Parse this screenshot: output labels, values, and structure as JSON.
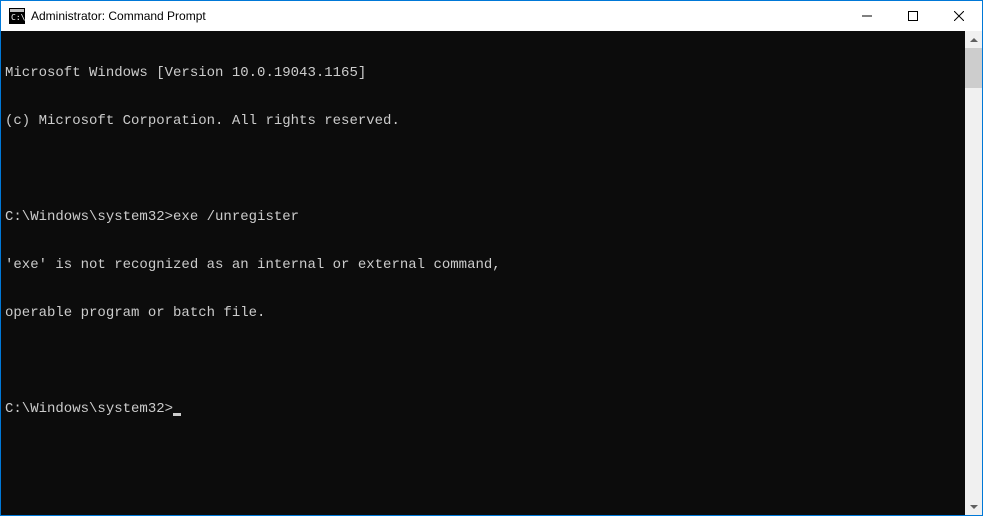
{
  "window": {
    "title": "Administrator: Command Prompt"
  },
  "terminal": {
    "lines": [
      "Microsoft Windows [Version 10.0.19043.1165]",
      "(c) Microsoft Corporation. All rights reserved.",
      "",
      "C:\\Windows\\system32>exe /unregister",
      "'exe' is not recognized as an internal or external command,",
      "operable program or batch file.",
      ""
    ],
    "prompt": "C:\\Windows\\system32>",
    "current_input": ""
  }
}
